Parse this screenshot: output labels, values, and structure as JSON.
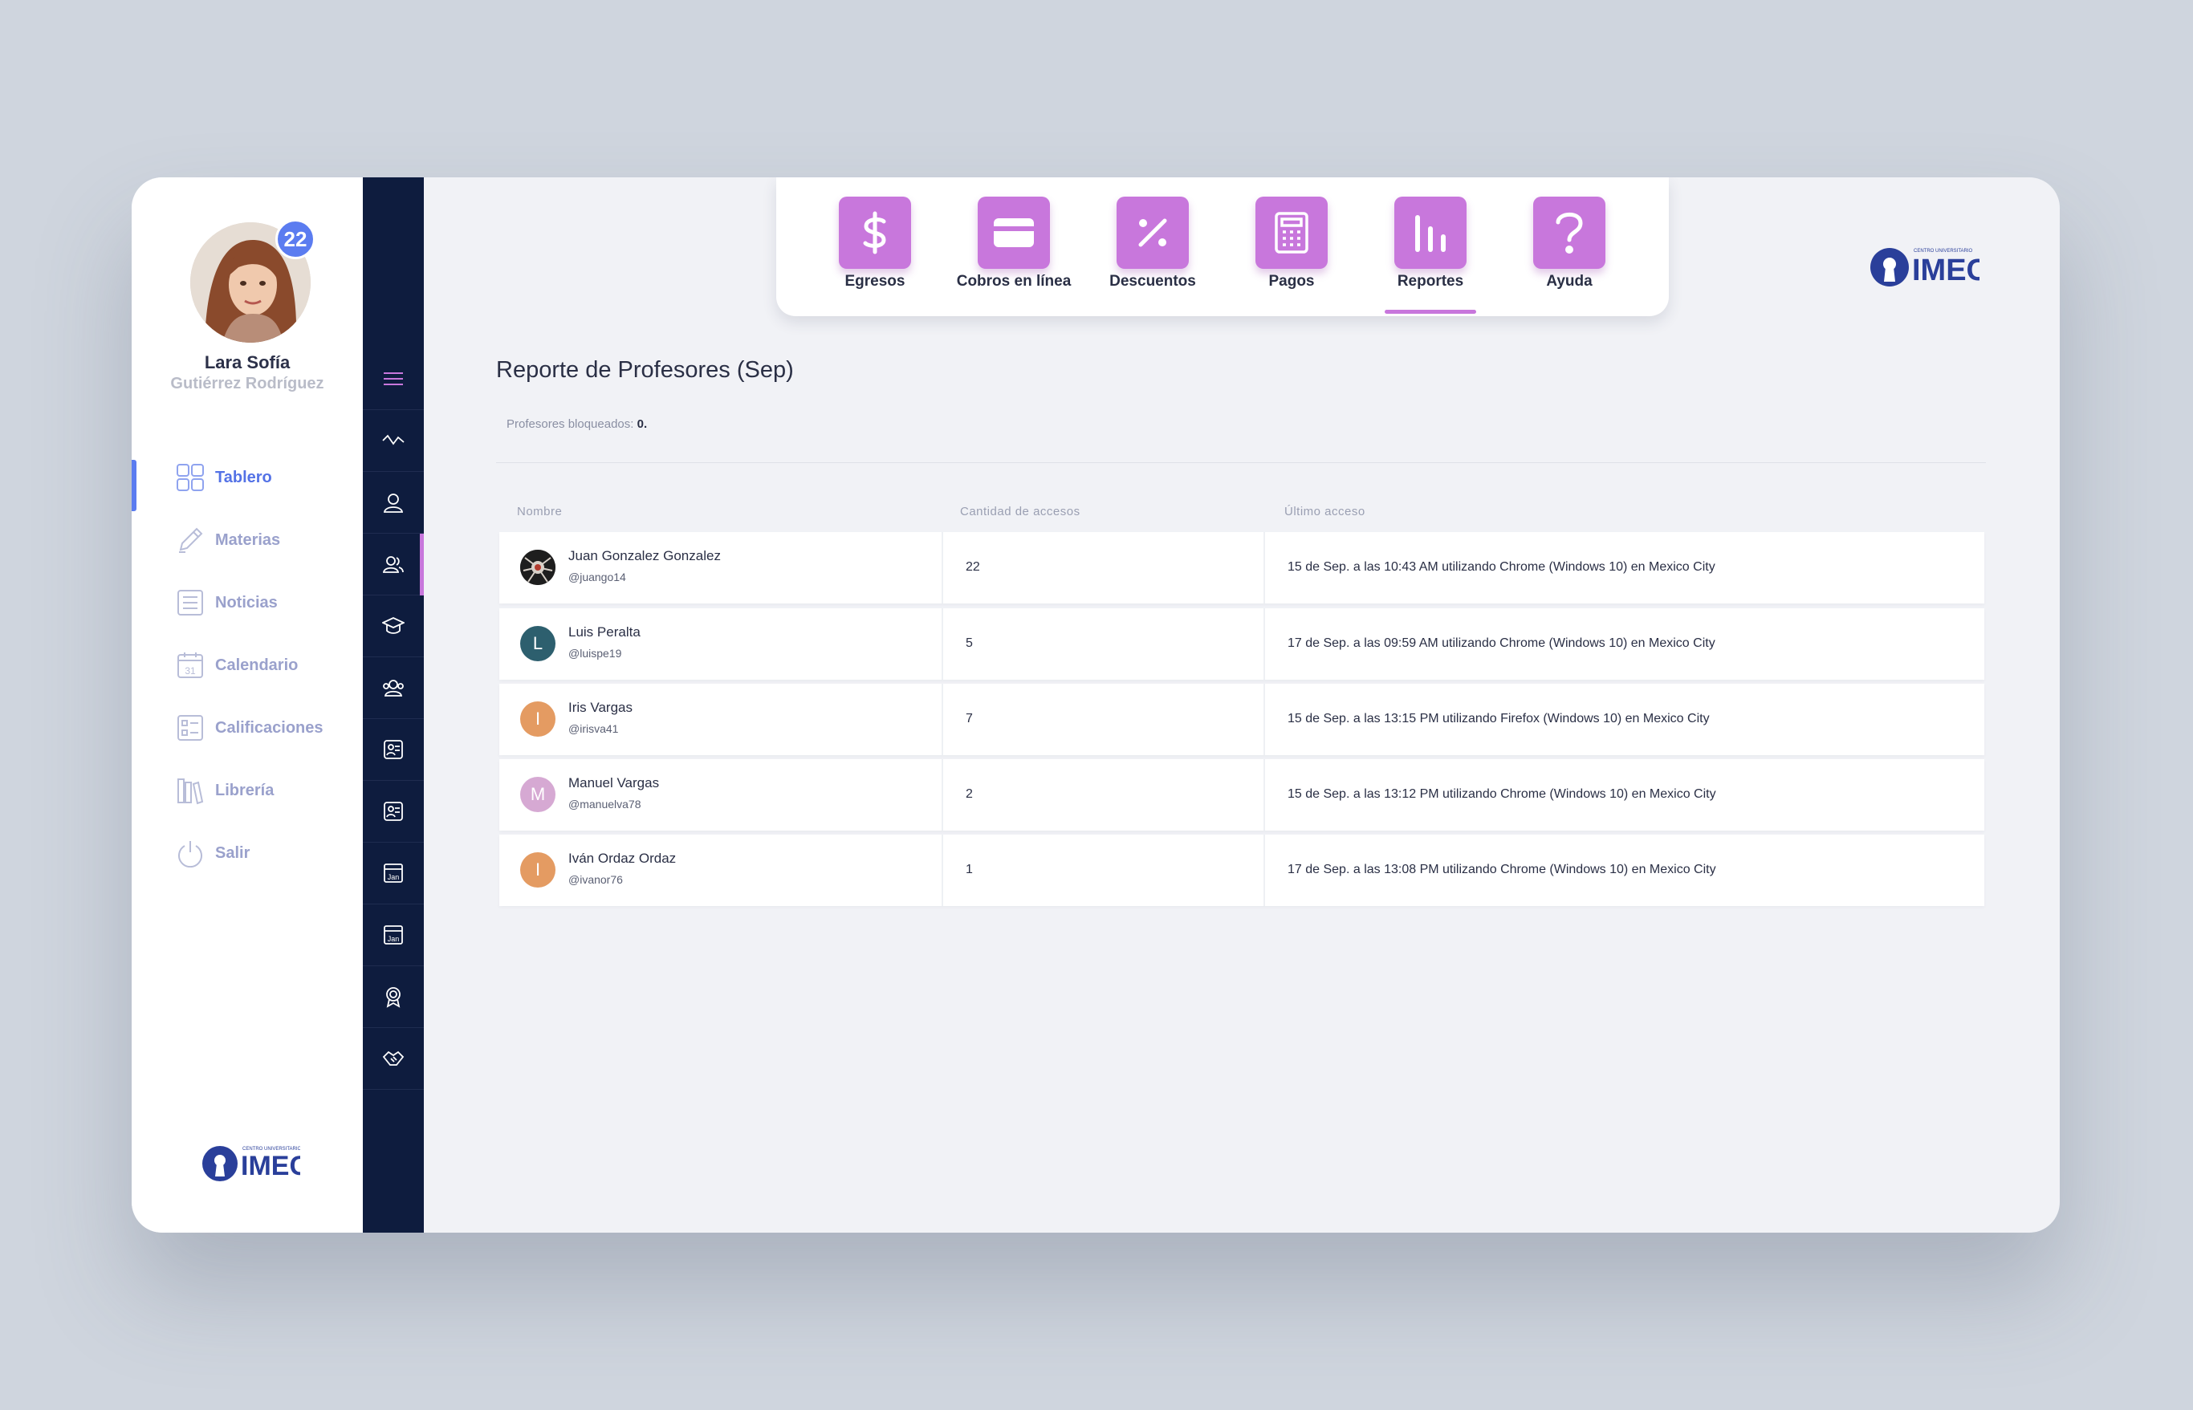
{
  "user": {
    "first_name": "Lara Sofía",
    "last_name": "Gutiérrez Rodríguez",
    "notifications": "22"
  },
  "nav": [
    {
      "label": "Tablero",
      "icon": "grid-icon",
      "active": true
    },
    {
      "label": "Materias",
      "icon": "pencil-icon"
    },
    {
      "label": "Noticias",
      "icon": "news-icon"
    },
    {
      "label": "Calendario",
      "icon": "calendar-icon",
      "icon_text": "31"
    },
    {
      "label": "Calificaciones",
      "icon": "checklist-icon"
    },
    {
      "label": "Librería",
      "icon": "library-icon"
    },
    {
      "label": "Salir",
      "icon": "power-icon"
    }
  ],
  "strip": [
    {
      "icon": "menu-icon"
    },
    {
      "icon": "activity-icon"
    },
    {
      "icon": "user-icon"
    },
    {
      "icon": "users-icon",
      "active": true
    },
    {
      "icon": "graduation-cap-icon"
    },
    {
      "icon": "group-icon"
    },
    {
      "icon": "id-card-icon"
    },
    {
      "icon": "id-card-icon"
    },
    {
      "icon": "calendar-jan-icon",
      "icon_text": "Jan"
    },
    {
      "icon": "calendar-jan-icon",
      "icon_text": "Jan"
    },
    {
      "icon": "award-icon"
    },
    {
      "icon": "handshake-icon"
    }
  ],
  "toolbar": [
    {
      "label": "Egresos",
      "icon": "dollar-icon"
    },
    {
      "label": "Cobros en línea",
      "icon": "credit-card-icon"
    },
    {
      "label": "Descuentos",
      "icon": "percent-icon"
    },
    {
      "label": "Pagos",
      "icon": "calculator-icon"
    },
    {
      "label": "Reportes",
      "icon": "bar-chart-icon",
      "active": true
    },
    {
      "label": "Ayuda",
      "icon": "question-icon"
    }
  ],
  "logo": {
    "text": "IMEC",
    "tagline": "CENTRO UNIVERSITARIO"
  },
  "page": {
    "title": "Reporte de Profesores (Sep)",
    "blocked_label": "Profesores bloqueados: ",
    "blocked_value": "0."
  },
  "table": {
    "headers": [
      "Nombre",
      "Cantidad de accesos",
      "Último acceso"
    ],
    "rows": [
      {
        "initial": "",
        "avatar_color": "#222222",
        "name": "Juan Gonzalez Gonzalez",
        "handle": "@juango14",
        "count": "22",
        "last": "15 de Sep. a las 10:43 AM utilizando Chrome (Windows 10) en Mexico City"
      },
      {
        "initial": "L",
        "avatar_color": "#2d5f6e",
        "name": "Luis Peralta",
        "handle": "@luispe19",
        "count": "5",
        "last": "17 de Sep. a las 09:59 AM utilizando Chrome (Windows 10) en Mexico City"
      },
      {
        "initial": "I",
        "avatar_color": "#e49b62",
        "name": "Iris Vargas",
        "handle": "@irisva41",
        "count": "7",
        "last": "15 de Sep. a las 13:15 PM utilizando Firefox (Windows 10) en Mexico City"
      },
      {
        "initial": "M",
        "avatar_color": "#d6a9d3",
        "name": "Manuel Vargas",
        "handle": "@manuelva78",
        "count": "2",
        "last": "15 de Sep. a las 13:12 PM utilizando Chrome (Windows 10) en Mexico City"
      },
      {
        "initial": "I",
        "avatar_color": "#e49b62",
        "name": "Iván Ordaz Ordaz",
        "handle": "@ivanor76",
        "count": "1",
        "last": "17 de Sep. a las 13:08 PM utilizando Chrome (Windows 10) en Mexico City"
      }
    ]
  },
  "colors": {
    "accent": "#5b7cf0",
    "tile": "#c877dc",
    "strip": "#0e1c3e"
  }
}
